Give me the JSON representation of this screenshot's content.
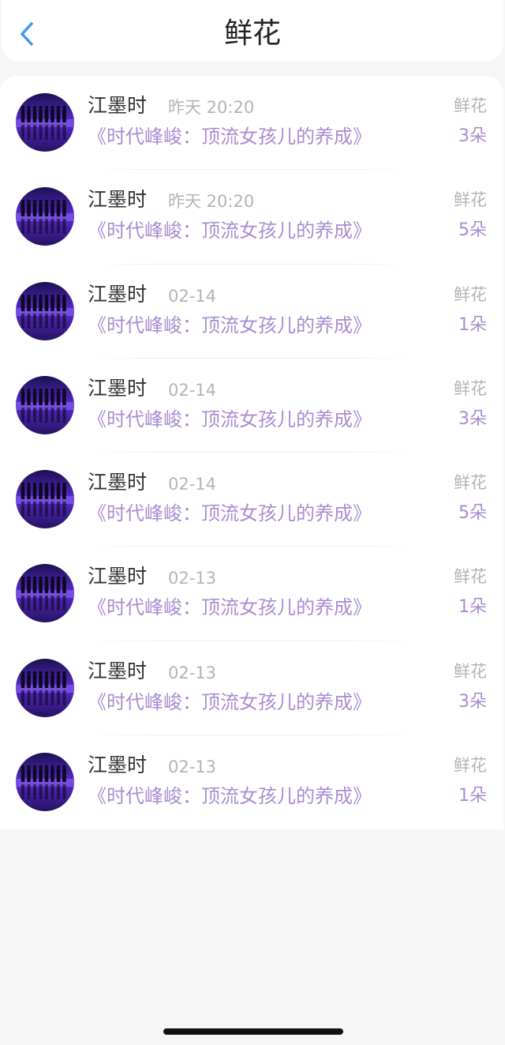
{
  "header": {
    "title": "鲜花",
    "back_icon": "chevron-left-icon",
    "accent_color": "#3d9bf0"
  },
  "colors": {
    "link_purple": "#a98cd0",
    "muted_gray": "#b4b4b4"
  },
  "records": [
    {
      "name": "江墨时",
      "time": "昨天 20:20",
      "book": "《时代峰峻：顶流女孩儿的养成》",
      "gift_type": "鲜花",
      "gift_count": "3朵"
    },
    {
      "name": "江墨时",
      "time": "昨天 20:20",
      "book": "《时代峰峻：顶流女孩儿的养成》",
      "gift_type": "鲜花",
      "gift_count": "5朵"
    },
    {
      "name": "江墨时",
      "time": "02-14",
      "book": "《时代峰峻：顶流女孩儿的养成》",
      "gift_type": "鲜花",
      "gift_count": "1朵"
    },
    {
      "name": "江墨时",
      "time": "02-14",
      "book": "《时代峰峻：顶流女孩儿的养成》",
      "gift_type": "鲜花",
      "gift_count": "3朵"
    },
    {
      "name": "江墨时",
      "time": "02-14",
      "book": "《时代峰峻：顶流女孩儿的养成》",
      "gift_type": "鲜花",
      "gift_count": "5朵"
    },
    {
      "name": "江墨时",
      "time": "02-13",
      "book": "《时代峰峻：顶流女孩儿的养成》",
      "gift_type": "鲜花",
      "gift_count": "1朵"
    },
    {
      "name": "江墨时",
      "time": "02-13",
      "book": "《时代峰峻：顶流女孩儿的养成》",
      "gift_type": "鲜花",
      "gift_count": "3朵"
    },
    {
      "name": "江墨时",
      "time": "02-13",
      "book": "《时代峰峻：顶流女孩儿的养成》",
      "gift_type": "鲜花",
      "gift_count": "1朵"
    }
  ]
}
